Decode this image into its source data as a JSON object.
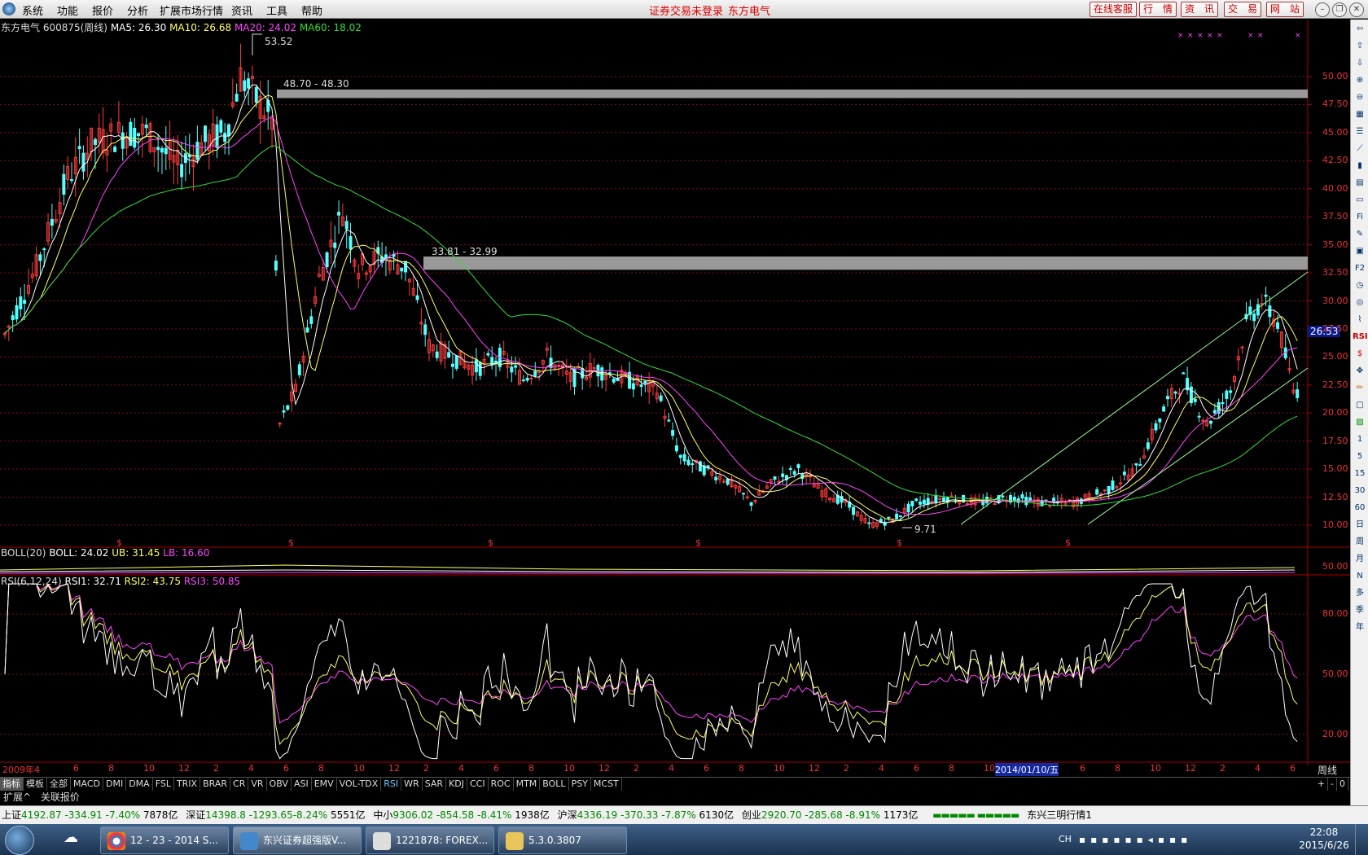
{
  "menubar": {
    "items": [
      "系统",
      "功能",
      "报价",
      "分析",
      "扩展市场行情",
      "资讯",
      "工具",
      "帮助"
    ],
    "center_status": "证券交易未登录",
    "center_stock": "东方电气",
    "buttons": [
      "在线客服",
      "行　情",
      "资　讯",
      "交　易",
      "网　站"
    ]
  },
  "main_legend": {
    "stock": "东方电气 600875(周线)",
    "ma5": "MA5: 26.30",
    "ma10": "MA10: 26.68",
    "ma20": "MA20: 24.02",
    "ma60": "MA60: 18.02"
  },
  "boll_legend": {
    "name": "BOLL(20)",
    "boll": "BOLL: 24.02",
    "ub": "UB: 31.45",
    "lb": "LB: 16.60"
  },
  "rsi_legend": {
    "name": "RSI(6,12,24)",
    "rsi1": "RSI1: 32.71",
    "rsi2": "RSI2: 43.75",
    "rsi3": "RSI3: 50.85"
  },
  "annotations": {
    "high": "53.52",
    "low": "9.71",
    "band1": "48.70 - 48.30",
    "band2": "33.81 - 32.99",
    "current_price": "26.53"
  },
  "price_axis": [
    "50.00",
    "47.50",
    "45.00",
    "42.50",
    "40.00",
    "37.50",
    "35.00",
    "32.50",
    "30.00",
    "27.50",
    "25.00",
    "22.50",
    "20.00",
    "17.50",
    "15.00",
    "12.50",
    "10.00"
  ],
  "boll_axis": [
    "50.00"
  ],
  "rsi_axis": [
    "80.00",
    "50.00",
    "20.00"
  ],
  "time_axis": {
    "labels": [
      "2009年4",
      "6",
      "8",
      "10",
      "12",
      "2",
      "4",
      "6",
      "8",
      "10",
      "12",
      "2",
      "4",
      "6",
      "8",
      "10",
      "12",
      "2",
      "4",
      "6",
      "8",
      "10",
      "12",
      "2",
      "4",
      "6",
      "8",
      "10",
      "12",
      "2014/01/10/五",
      "6",
      "8",
      "10",
      "12",
      "2",
      "4",
      "6"
    ],
    "period": "周线"
  },
  "colors": {
    "up": "#ff3b3b",
    "down": "#54ffff",
    "ma5": "#ffffff",
    "ma10": "#ffff66",
    "ma20": "#ff44ff",
    "ma60": "#33dd33",
    "grid": "#7a1010"
  },
  "indicator_tabs": [
    "指标",
    "模板",
    "全部",
    "MACD",
    "DMI",
    "DMA",
    "FSL",
    "TRIX",
    "BRAR",
    "CR",
    "VR",
    "OBV",
    "ASI",
    "EMV",
    "VOL-TDX",
    "RSI",
    "WR",
    "SAR",
    "KDJ",
    "CCI",
    "ROC",
    "MTM",
    "BOLL",
    "PSY",
    "MCST"
  ],
  "indicator_tabs_right": [
    "+",
    "-",
    "0"
  ],
  "ext_tabs": [
    "扩展^",
    "关联报价"
  ],
  "right_toolbar": [
    "Fi",
    "F2",
    "RSI",
    "1",
    "5",
    "15",
    "30",
    "60",
    "日",
    "周",
    "月",
    "N",
    "多",
    "季",
    "年"
  ],
  "statusbar": {
    "sh": {
      "label": "上证",
      "value": "4192.87",
      "chg": "-334.91",
      "pct": "-7.40%",
      "amt": "7878亿"
    },
    "sz": {
      "label": "深证",
      "value": "14398.8",
      "chg": "-1293.65",
      "pct": "-8.24%",
      "amt": "5551亿"
    },
    "zx": {
      "label": "中小",
      "value": "9306.02",
      "chg": "-854.58",
      "pct": "-8.41%",
      "amt": "1938亿"
    },
    "hs": {
      "label": "沪深",
      "value": "4336.19",
      "chg": "-370.33",
      "pct": "-7.87%",
      "amt": "6130亿"
    },
    "cy": {
      "label": "创业",
      "value": "2920.70",
      "chg": "-285.68",
      "pct": "-8.91%",
      "amt": "1173亿"
    },
    "broker": "东兴三明行情1"
  },
  "taskbar": {
    "tasks": [
      "12 - 23 - 2014 S...",
      "东兴证券超强版V...",
      "1221878: FOREX...",
      "5.3.0.3807"
    ],
    "lang": "CH",
    "time": "22:08",
    "date": "2015/6/26"
  }
}
